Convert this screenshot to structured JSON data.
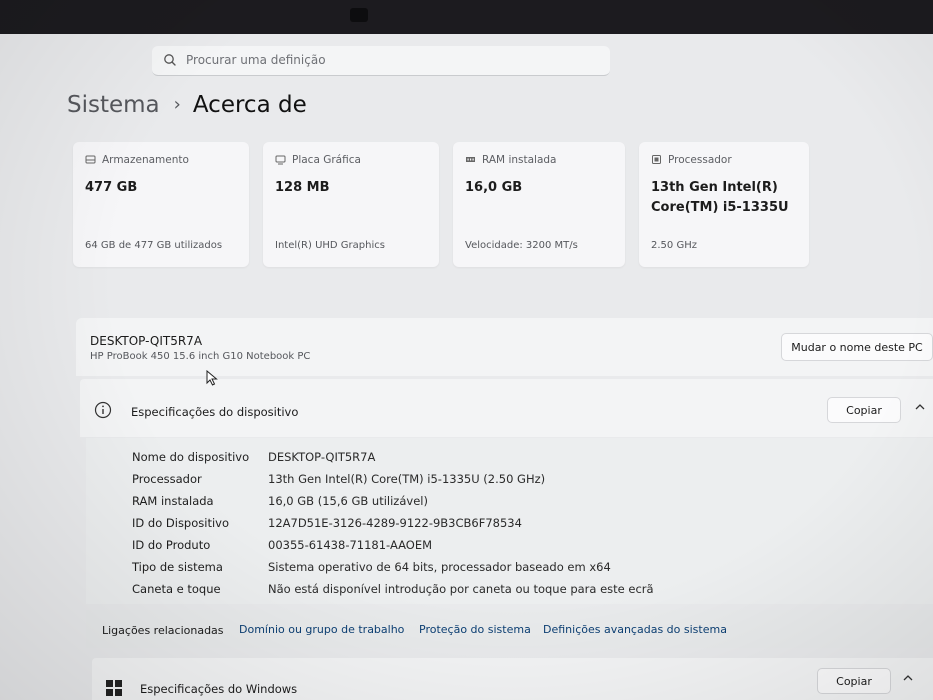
{
  "search": {
    "placeholder": "Procurar uma definição"
  },
  "breadcrumb": {
    "parent": "Sistema",
    "separator": "›",
    "current": "Acerca de"
  },
  "cards": [
    {
      "title": "Armazenamento",
      "value": "477 GB",
      "sub": "64 GB de 477 GB utilizados",
      "icon": "storage-icon"
    },
    {
      "title": "Placa Gráfica",
      "value": "128 MB",
      "sub": "Intel(R) UHD Graphics",
      "icon": "graphics-card-icon"
    },
    {
      "title": "RAM instalada",
      "value": "16,0 GB",
      "sub": "Velocidade: 3200 MT/s",
      "icon": "ram-icon"
    },
    {
      "title": "Processador",
      "value": "13th Gen Intel(R) Core(TM) i5-1335U",
      "sub": "2.50 GHz",
      "icon": "processor-icon"
    }
  ],
  "device": {
    "name": "DESKTOP-QIT5R7A",
    "model": "HP ProBook 450 15.6 inch G10 Notebook PC",
    "rename_label": "Mudar o nome deste PC"
  },
  "specs": {
    "title": "Especificações do dispositivo",
    "copy_label": "Copiar",
    "rows": [
      {
        "label": "Nome do dispositivo",
        "value": "DESKTOP-QIT5R7A"
      },
      {
        "label": "Processador",
        "value": "13th Gen Intel(R) Core(TM) i5-1335U (2.50 GHz)"
      },
      {
        "label": "RAM instalada",
        "value": "16,0 GB (15,6 GB utilizável)"
      },
      {
        "label": "ID do Dispositivo",
        "value": "12A7D51E-3126-4289-9122-9B3CB6F78534"
      },
      {
        "label": "ID do Produto",
        "value": "00355-61438-71181-AAOEM"
      },
      {
        "label": "Tipo de sistema",
        "value": "Sistema operativo de 64 bits, processador baseado em x64"
      },
      {
        "label": "Caneta e toque",
        "value": "Não está disponível introdução por caneta ou toque para este ecrã"
      }
    ]
  },
  "related": {
    "label": "Ligações relacionadas",
    "links": [
      "Domínio ou grupo de trabalho",
      "Proteção do sistema",
      "Definições avançadas do sistema"
    ]
  },
  "windows_specs": {
    "title": "Especificações do Windows",
    "copy_label": "Copiar"
  },
  "colors": {
    "accent_link": "#0c3f73",
    "page_bg": "#e9eaec",
    "card_bg": "#f6f6f8"
  }
}
